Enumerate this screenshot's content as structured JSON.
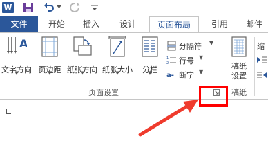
{
  "qat": {
    "app_icon": "word-icon",
    "app_letter": "W",
    "save": "save-icon",
    "undo": "undo-icon",
    "redo": "redo-icon",
    "customize": "customize-qat-icon"
  },
  "tabs": [
    {
      "label": "文件"
    },
    {
      "label": "开始"
    },
    {
      "label": "插入"
    },
    {
      "label": "设计"
    },
    {
      "label": "页面布局"
    },
    {
      "label": "引用"
    },
    {
      "label": "邮件"
    }
  ],
  "ribbon": {
    "page_setup": {
      "text_direction": "文字方向",
      "margins": "页边距",
      "orientation": "纸张方向",
      "size": "纸张大小",
      "columns": "分栏",
      "breaks": "分隔符",
      "line_numbers": "行号",
      "hyphenation": "断字",
      "group_label": "页面设置"
    },
    "manuscript": {
      "settings_line1": "稿纸",
      "settings_line2": "设置",
      "group_label": "稿纸"
    },
    "indent_partial": "缩"
  },
  "colors": {
    "accent": "#2b579a",
    "highlight_box": "#ff0000",
    "arrow": "#ef3b2d"
  }
}
